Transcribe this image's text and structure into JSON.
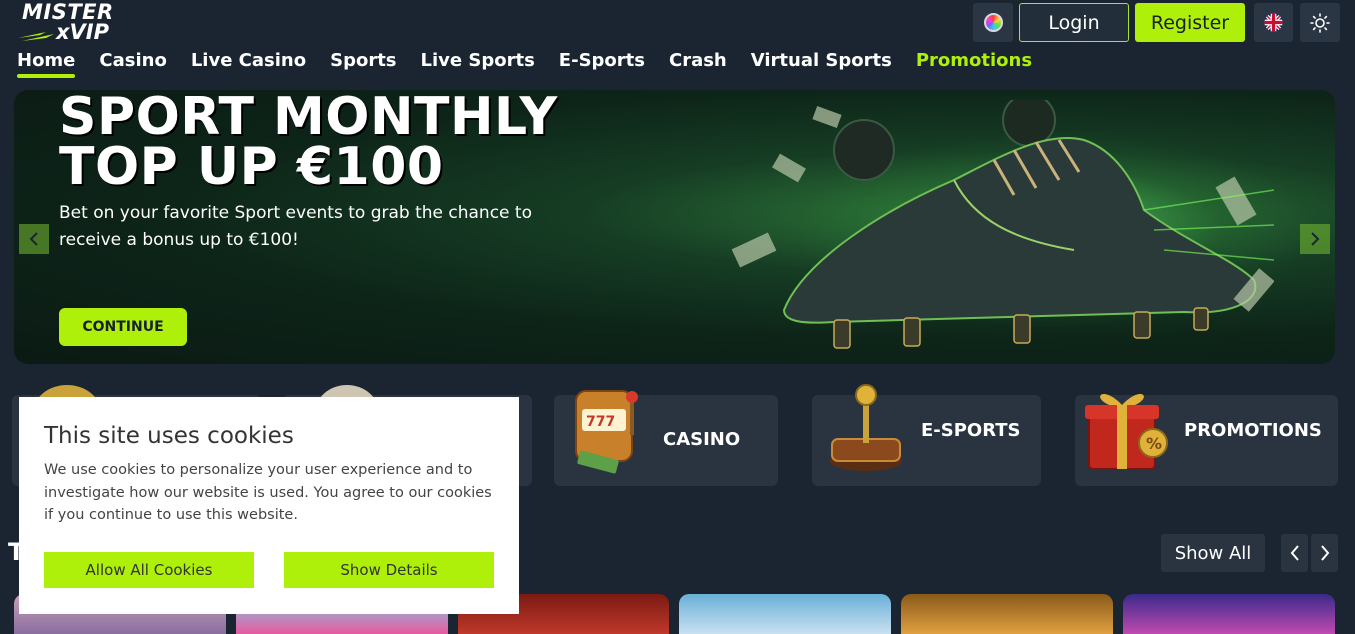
{
  "brand": {
    "line1": "MISTER",
    "line2": "xVIP",
    "accent": "#aef00a"
  },
  "header": {
    "color_picker_icon": "color-wheel-icon",
    "login_label": "Login",
    "register_label": "Register",
    "language_icon": "uk-flag-icon",
    "theme_icon": "sun-icon"
  },
  "nav": {
    "items": [
      {
        "label": "Home",
        "active": true
      },
      {
        "label": "Casino"
      },
      {
        "label": "Live Casino"
      },
      {
        "label": "Sports"
      },
      {
        "label": "Live Sports"
      },
      {
        "label": "E-Sports"
      },
      {
        "label": "Crash"
      },
      {
        "label": "Virtual Sports"
      },
      {
        "label": "Promotions",
        "highlight": true
      }
    ]
  },
  "banner": {
    "title_line1": "SPORT MONTHLY",
    "title_line2": "TOP UP €100",
    "subtitle": "Bet on your favorite Sport events to grab the chance to receive a bonus up to €100!",
    "cta": "CONTINUE"
  },
  "categories": [
    {
      "label": "CASINO",
      "icon": "slot-machine-icon"
    },
    {
      "label": "E-SPORTS",
      "icon": "joystick-icon"
    },
    {
      "label": "PROMOTIONS",
      "icon": "gift-box-icon"
    }
  ],
  "games": {
    "show_all": "Show All",
    "prev_icon": "chevron-left-icon",
    "next_icon": "chevron-right-icon",
    "section_title_initial": "T"
  },
  "cookie": {
    "title": "This site uses cookies",
    "text": "We use cookies to personalize your user experience and to investigate how our website is used. You agree to our cookies if you continue to use this website.",
    "allow_label": "Allow All Cookies",
    "details_label": "Show Details"
  }
}
